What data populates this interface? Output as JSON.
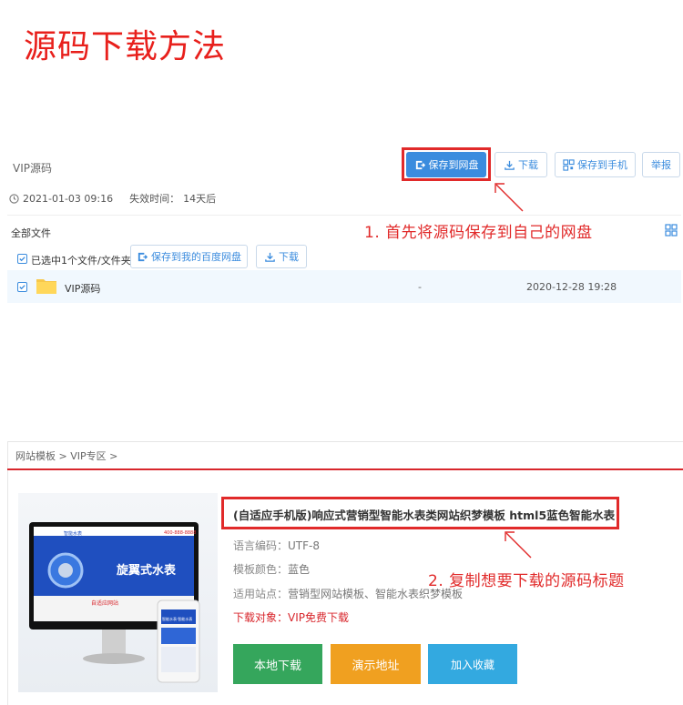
{
  "heading": "源码下载方法",
  "share": {
    "file_name": "VIP源码",
    "buttons": {
      "save_to_disk": "保存到网盘",
      "download": "下载",
      "save_to_phone": "保存到手机",
      "report": "举报"
    },
    "date": "2021-01-03 09:16",
    "expiry_label": "失效时间：",
    "expiry_value": "14天后",
    "all_files": "全部文件",
    "selected_text": "已选中1个文件/文件夹",
    "toolbar": {
      "save_to_baidu": "保存到我的百度网盘",
      "download": "下载"
    },
    "row": {
      "name": "VIP源码",
      "size": "-",
      "date": "2020-12-28 19:28"
    }
  },
  "annotations": {
    "step1": "1. 首先将源码保存到自己的网盘",
    "step2": "2. 复制想要下载的源码标题"
  },
  "product": {
    "breadcrumb": "网站模板 > VIP专区 >",
    "title": "(自适应手机版)响应式营销型智能水表类网站织梦模板 html5蓝色智能水表",
    "image_text": {
      "brand": "智能水表",
      "phone": "400-888-8888",
      "banner": "旋翼式水表",
      "sub": "自适应网站",
      "mobile_heading": "智能水表·智能水表"
    },
    "attrs": {
      "encoding_label": "语言编码：",
      "encoding_value": "UTF-8",
      "color_label": "模板颜色：",
      "color_value": "蓝色",
      "sites_label": "适用站点：",
      "sites_value": "营销型网站模板、智能水表织梦模板",
      "target_label": "下载对象：",
      "target_value": "VIP免费下载"
    },
    "buttons": {
      "local_download": "本地下载",
      "demo": "演示地址",
      "favorite": "加入收藏"
    }
  },
  "colors": {
    "accent": "#3b8cde",
    "annotation_red": "#e12a2a",
    "green": "#35a65c",
    "orange": "#f0a020",
    "light_blue": "#33a9e0"
  }
}
